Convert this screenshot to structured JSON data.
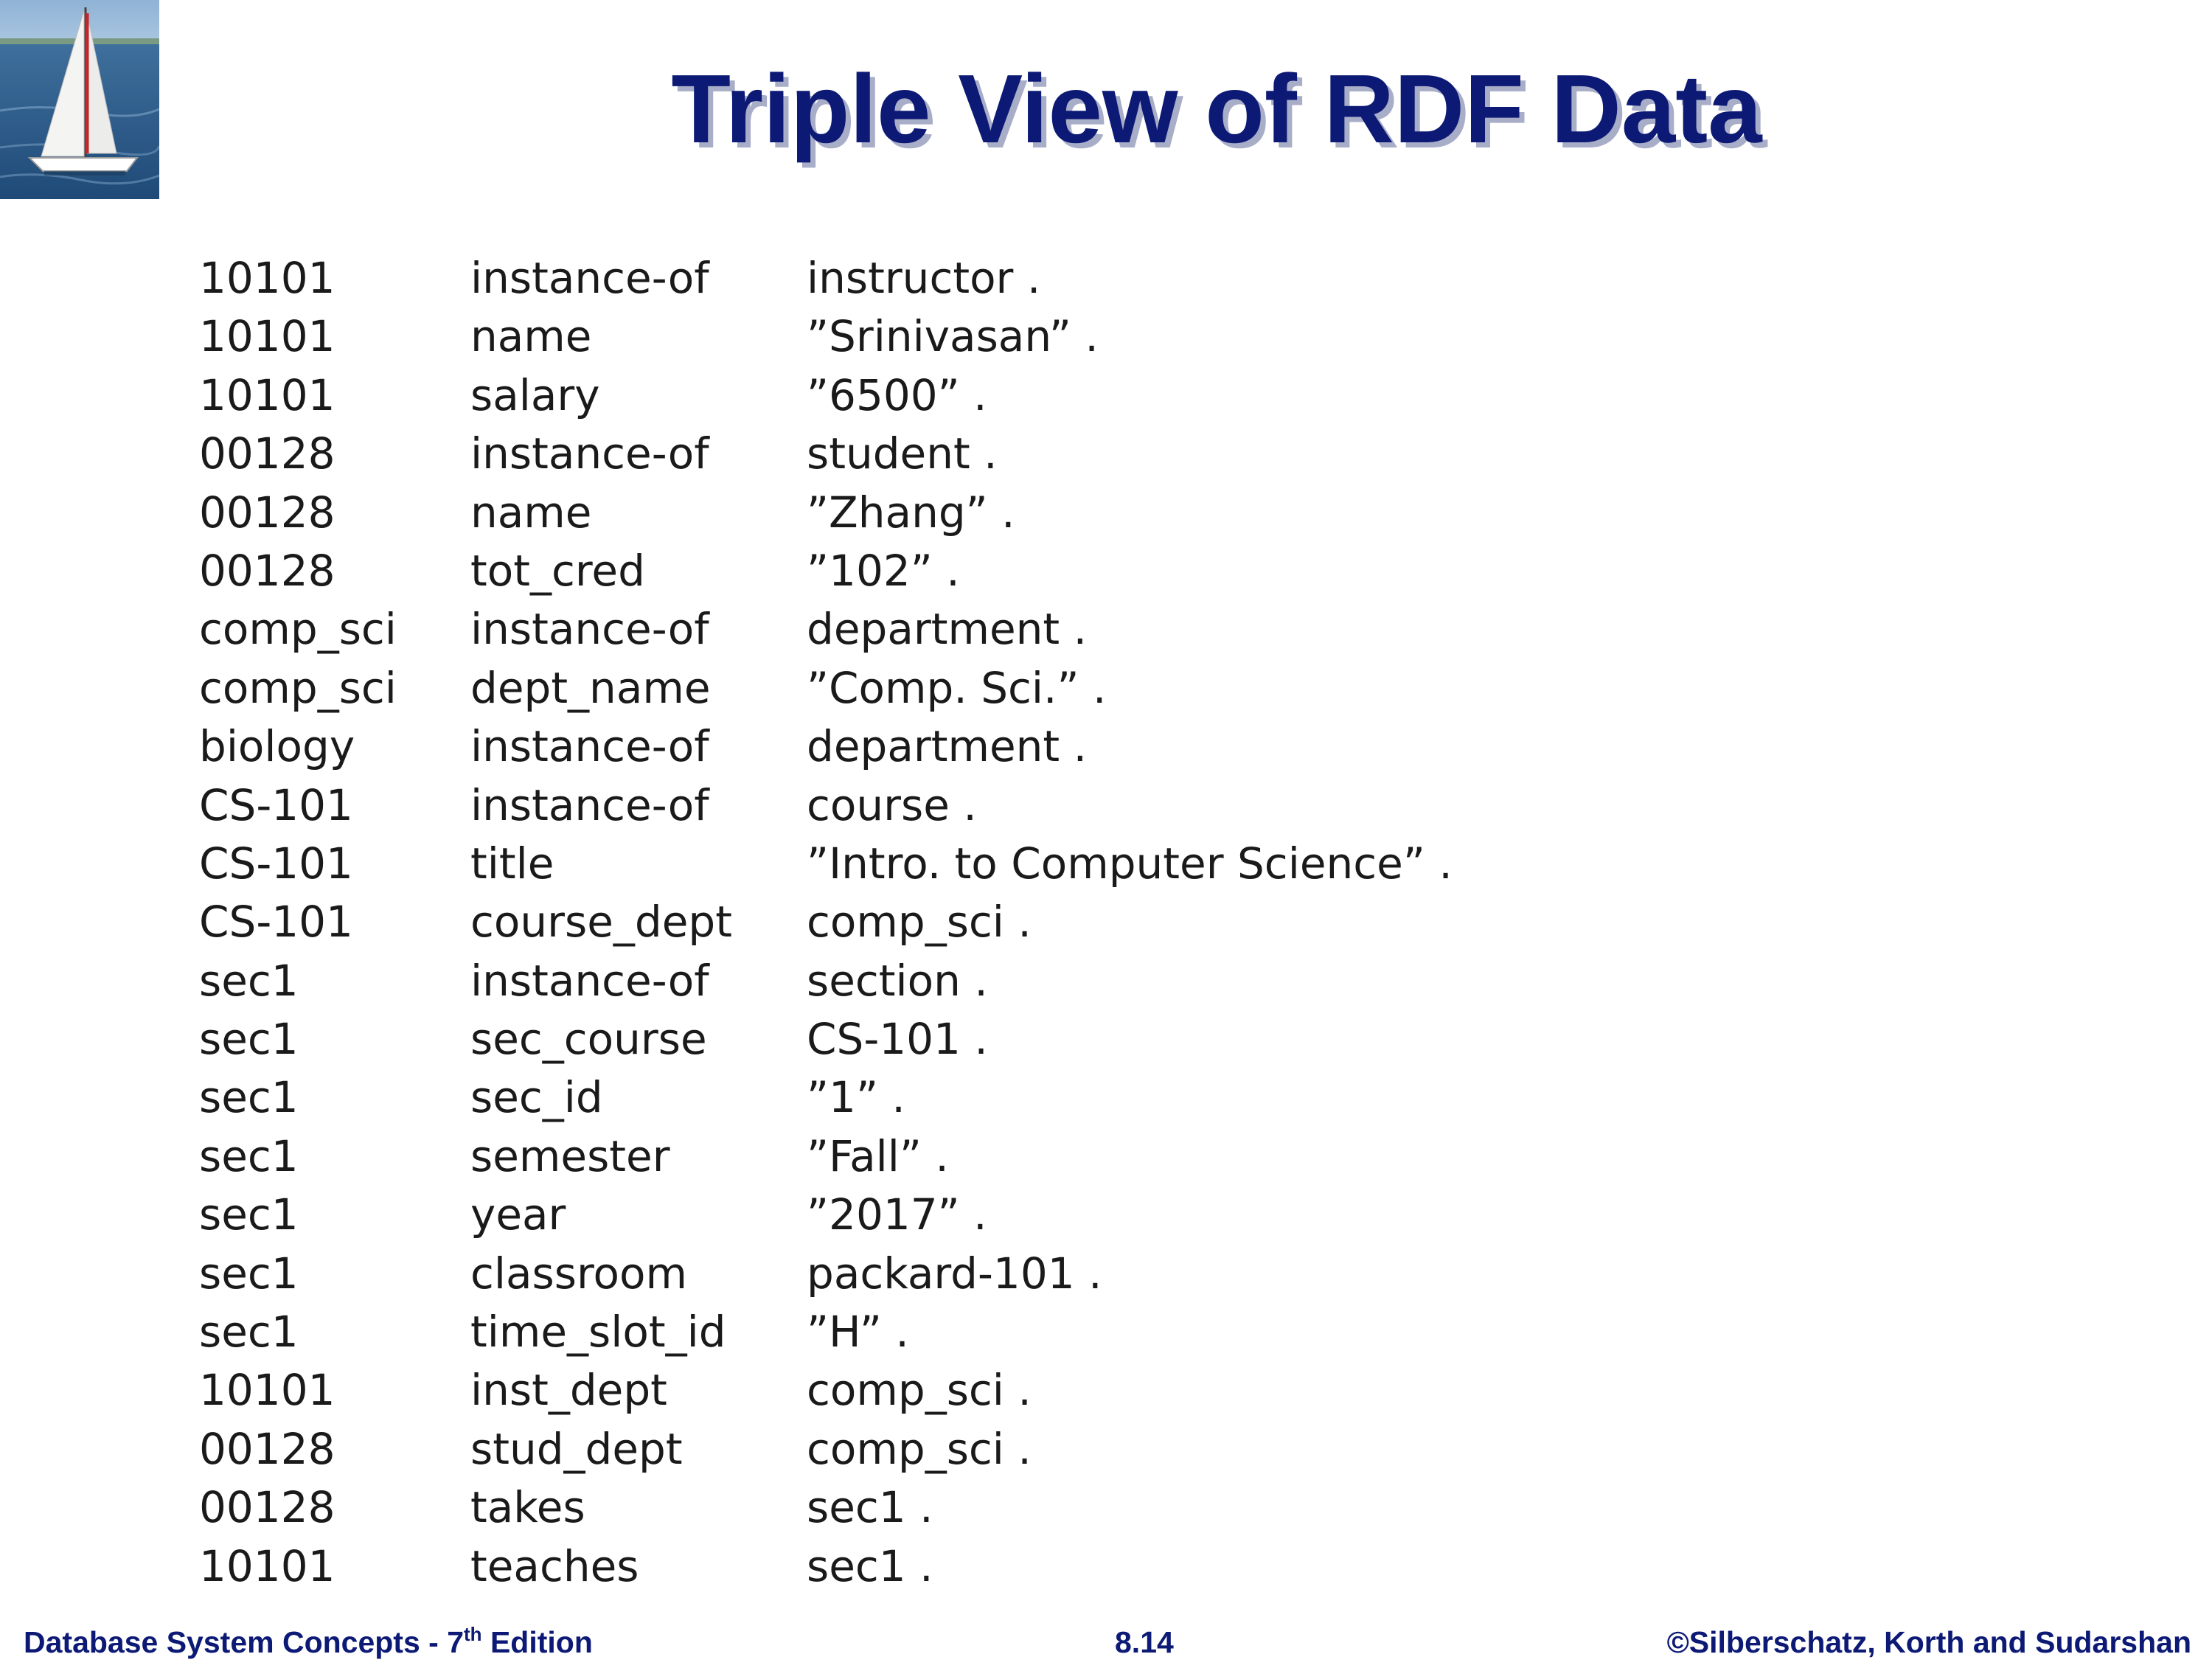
{
  "slide": {
    "title": "Triple View of RDF Data"
  },
  "triples": [
    {
      "subject": "10101",
      "predicate": "instance-of",
      "object": "instructor ."
    },
    {
      "subject": "10101",
      "predicate": "name",
      "object": "”Srinivasan” ."
    },
    {
      "subject": "10101",
      "predicate": "salary",
      "object": "”6500” ."
    },
    {
      "subject": "00128",
      "predicate": "instance-of",
      "object": "student ."
    },
    {
      "subject": "00128",
      "predicate": "name",
      "object": "”Zhang” ."
    },
    {
      "subject": "00128",
      "predicate": "tot_cred",
      "object": "”102” ."
    },
    {
      "subject": "comp_sci",
      "predicate": "instance-of",
      "object": "department ."
    },
    {
      "subject": "comp_sci",
      "predicate": "dept_name",
      "object": "”Comp. Sci.” ."
    },
    {
      "subject": "biology",
      "predicate": "instance-of",
      "object": "department ."
    },
    {
      "subject": "CS-101",
      "predicate": "instance-of",
      "object": "course ."
    },
    {
      "subject": "CS-101",
      "predicate": "title",
      "object": "”Intro. to Computer Science” ."
    },
    {
      "subject": "CS-101",
      "predicate": "course_dept",
      "object": "comp_sci ."
    },
    {
      "subject": "sec1",
      "predicate": "instance-of",
      "object": "section ."
    },
    {
      "subject": "sec1",
      "predicate": "sec_course",
      "object": "CS-101 ."
    },
    {
      "subject": "sec1",
      "predicate": "sec_id",
      "object": "”1” ."
    },
    {
      "subject": "sec1",
      "predicate": "semester",
      "object": "”Fall” ."
    },
    {
      "subject": "sec1",
      "predicate": "year",
      "object": "”2017” ."
    },
    {
      "subject": "sec1",
      "predicate": "classroom",
      "object": "packard-101 ."
    },
    {
      "subject": "sec1",
      "predicate": "time_slot_id",
      "object": "”H” ."
    },
    {
      "subject": "10101",
      "predicate": "inst_dept",
      "object": "comp_sci ."
    },
    {
      "subject": "00128",
      "predicate": "stud_dept",
      "object": "comp_sci ."
    },
    {
      "subject": "00128",
      "predicate": "takes",
      "object": "sec1 ."
    },
    {
      "subject": "10101",
      "predicate": "teaches",
      "object": "sec1 ."
    }
  ],
  "footer": {
    "left_prefix": "Database System Concepts - 7",
    "left_sup": "th",
    "left_suffix": " Edition",
    "center": "8.14",
    "right": "©Silberschatz, Korth and Sudarshan"
  },
  "colors": {
    "title": "#0d1a75",
    "title_shadow": "#a8adc8",
    "body_text": "#1a1a1a",
    "footer": "#0d1a75"
  },
  "logo": {
    "icon": "sailboat-icon"
  }
}
